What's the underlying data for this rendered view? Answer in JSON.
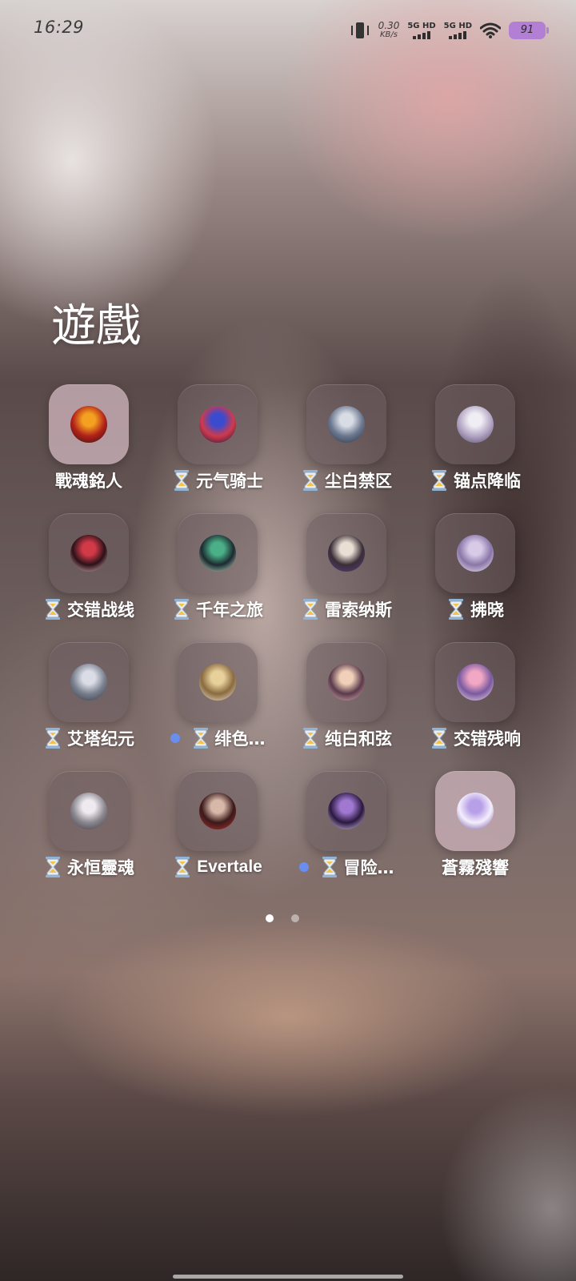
{
  "status_bar": {
    "time": "16:29",
    "net_speed_value": "0.30",
    "net_speed_unit": "KB/s",
    "sim1_label": "5G HD",
    "sim2_label": "5G HD",
    "battery_level": "91",
    "battery_color": "#b27fd4"
  },
  "folder": {
    "title": "遊戲"
  },
  "apps": [
    {
      "label": "戰魂銘人",
      "loading": false,
      "new": false,
      "icon": "flame-ring-avatar",
      "colors": [
        "#f4a020",
        "#b2221a",
        "#2b1210"
      ]
    },
    {
      "label": "元气骑士",
      "loading": true,
      "new": false,
      "icon": "knight-avatar",
      "colors": [
        "#3b4bd0",
        "#d03a4a",
        "#1a1640"
      ]
    },
    {
      "label": "尘白禁区",
      "loading": true,
      "new": false,
      "icon": "silver-hair-avatar",
      "colors": [
        "#d8dce4",
        "#6c7890",
        "#2a2f3e"
      ]
    },
    {
      "label": "锚点降临",
      "loading": true,
      "new": false,
      "icon": "white-hair-avatar",
      "colors": [
        "#f0eef4",
        "#b4a6c4",
        "#514868"
      ]
    },
    {
      "label": "交错战线",
      "loading": true,
      "new": false,
      "icon": "red-dark-avatar",
      "colors": [
        "#d23a48",
        "#2a1218",
        "#f0c0c8"
      ]
    },
    {
      "label": "千年之旅",
      "loading": true,
      "new": false,
      "icon": "green-hair-avatar",
      "colors": [
        "#4bb088",
        "#1c2a30",
        "#c8e8d0"
      ]
    },
    {
      "label": "雷索纳斯",
      "loading": true,
      "new": false,
      "icon": "dark-portrait-avatar",
      "colors": [
        "#eadfd4",
        "#3a2e36",
        "#5a3c8c"
      ]
    },
    {
      "label": "拂晓",
      "loading": true,
      "new": false,
      "icon": "lavender-hair-avatar",
      "colors": [
        "#d8cbe8",
        "#8a76a8",
        "#f4eef8"
      ]
    },
    {
      "label": "艾塔纪元",
      "loading": true,
      "new": false,
      "icon": "gray-hair-avatar",
      "colors": [
        "#dadde6",
        "#7a808e",
        "#30343e"
      ]
    },
    {
      "label": "绯色…",
      "loading": true,
      "new": true,
      "icon": "blonde-avatar",
      "colors": [
        "#e8d09a",
        "#8a6a40",
        "#f6ecd8"
      ]
    },
    {
      "label": "纯白和弦",
      "loading": true,
      "new": false,
      "icon": "duo-avatar",
      "colors": [
        "#f0d0b8",
        "#5a3a4a",
        "#e8b8c0"
      ]
    },
    {
      "label": "交错残响",
      "loading": true,
      "new": false,
      "icon": "pink-hair-avatar",
      "colors": [
        "#f2a8c4",
        "#7a5aa0",
        "#f8e0ea"
      ]
    },
    {
      "label": "永恒靈魂",
      "loading": true,
      "new": false,
      "icon": "white-haired-girl-avatar",
      "colors": [
        "#eeeaf0",
        "#8c8890",
        "#3a3640"
      ]
    },
    {
      "label": "Evertale",
      "loading": true,
      "new": false,
      "icon": "masked-avatar",
      "colors": [
        "#d8b8a8",
        "#3a1a1a",
        "#c03030"
      ]
    },
    {
      "label": "冒险…",
      "loading": true,
      "new": true,
      "icon": "purple-scene-avatar",
      "colors": [
        "#a078d0",
        "#2a1840",
        "#e8d8f8"
      ]
    },
    {
      "label": "蒼霧殘響",
      "loading": false,
      "new": false,
      "icon": "violet-hair-avatar",
      "colors": [
        "#b8a0e8",
        "#f4eefc",
        "#6a4a9a"
      ]
    }
  ],
  "pager": {
    "pages": 2,
    "current": 0
  },
  "icons": {
    "vibrate": "vibrate-icon",
    "wifi": "wifi-icon",
    "hourglass": "hourglass-icon"
  }
}
